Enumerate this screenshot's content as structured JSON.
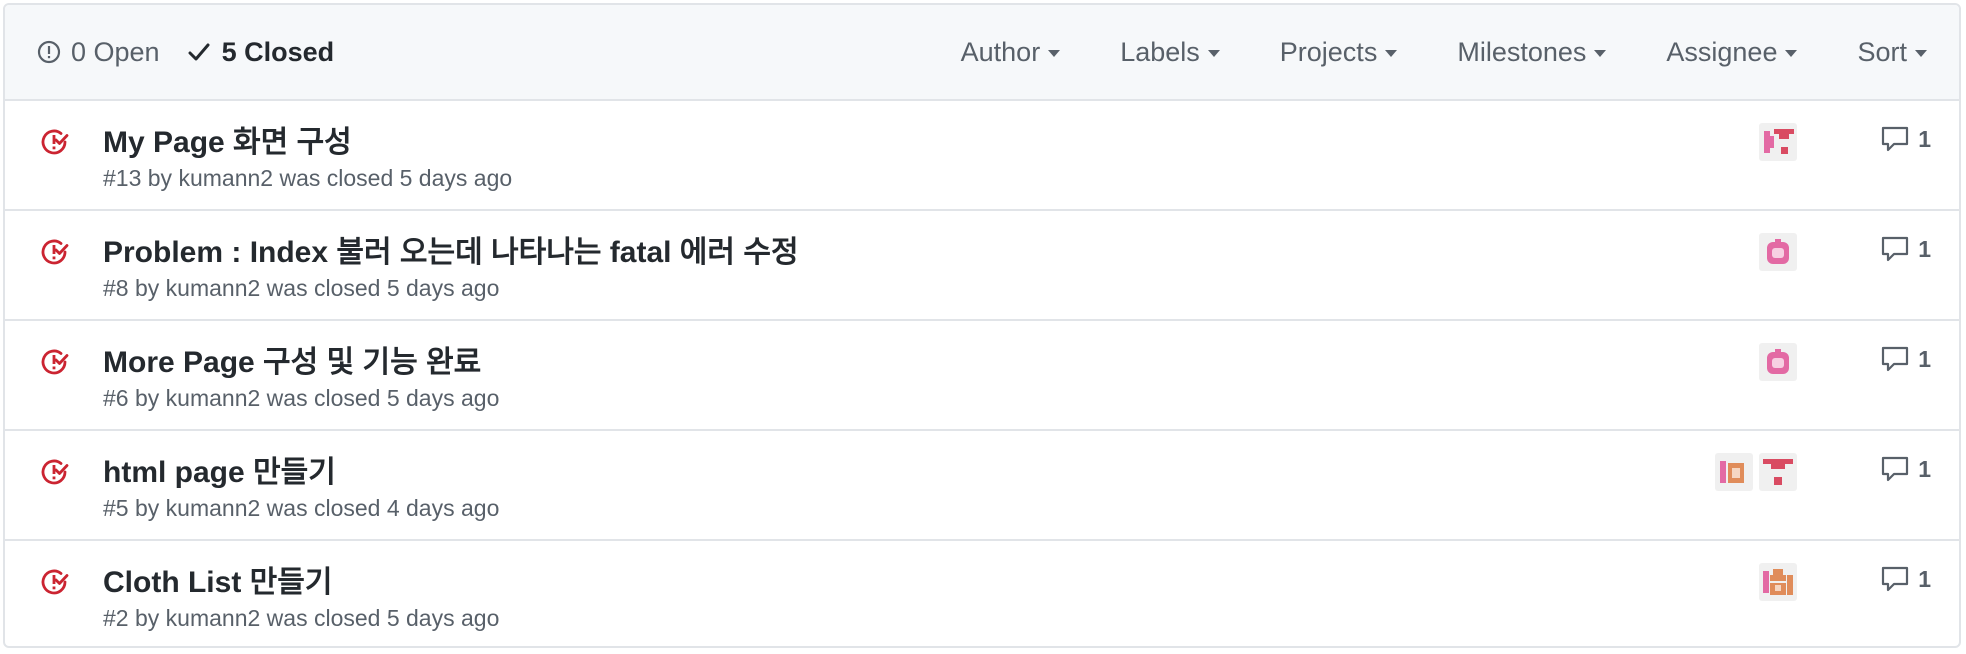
{
  "states": {
    "open_label": "0 Open",
    "closed_label": "5 Closed"
  },
  "filters": {
    "author": "Author",
    "labels": "Labels",
    "projects": "Projects",
    "milestones": "Milestones",
    "assignee": "Assignee",
    "sort": "Sort"
  },
  "icons": {
    "open": "issue-opened-icon",
    "closed_check": "check-icon",
    "row": "issue-closed-icon",
    "comment": "comment-icon",
    "caret": "triangle-down-icon"
  },
  "colors": {
    "closed_icon": "#cb2431",
    "header_bg": "#f6f8fa",
    "border": "#e1e4e8",
    "muted_text": "#586069"
  },
  "issues": [
    {
      "title": "My Page 화면 구성",
      "meta": "#13 by kumann2 was closed 5 days ago",
      "comments": "1"
    },
    {
      "title": "Problem : Index 불러 오는데 나타나는 fatal 에러 수정",
      "meta": "#8 by kumann2 was closed 5 days ago",
      "comments": "1"
    },
    {
      "title": "More Page 구성 및 기능 완료",
      "meta": "#6 by kumann2 was closed 5 days ago",
      "comments": "1"
    },
    {
      "title": "html page 만들기",
      "meta": "#5 by kumann2 was closed 4 days ago",
      "comments": "1"
    },
    {
      "title": "Cloth List 만들기",
      "meta": "#2 by kumann2 was closed 5 days ago",
      "comments": "1"
    }
  ]
}
